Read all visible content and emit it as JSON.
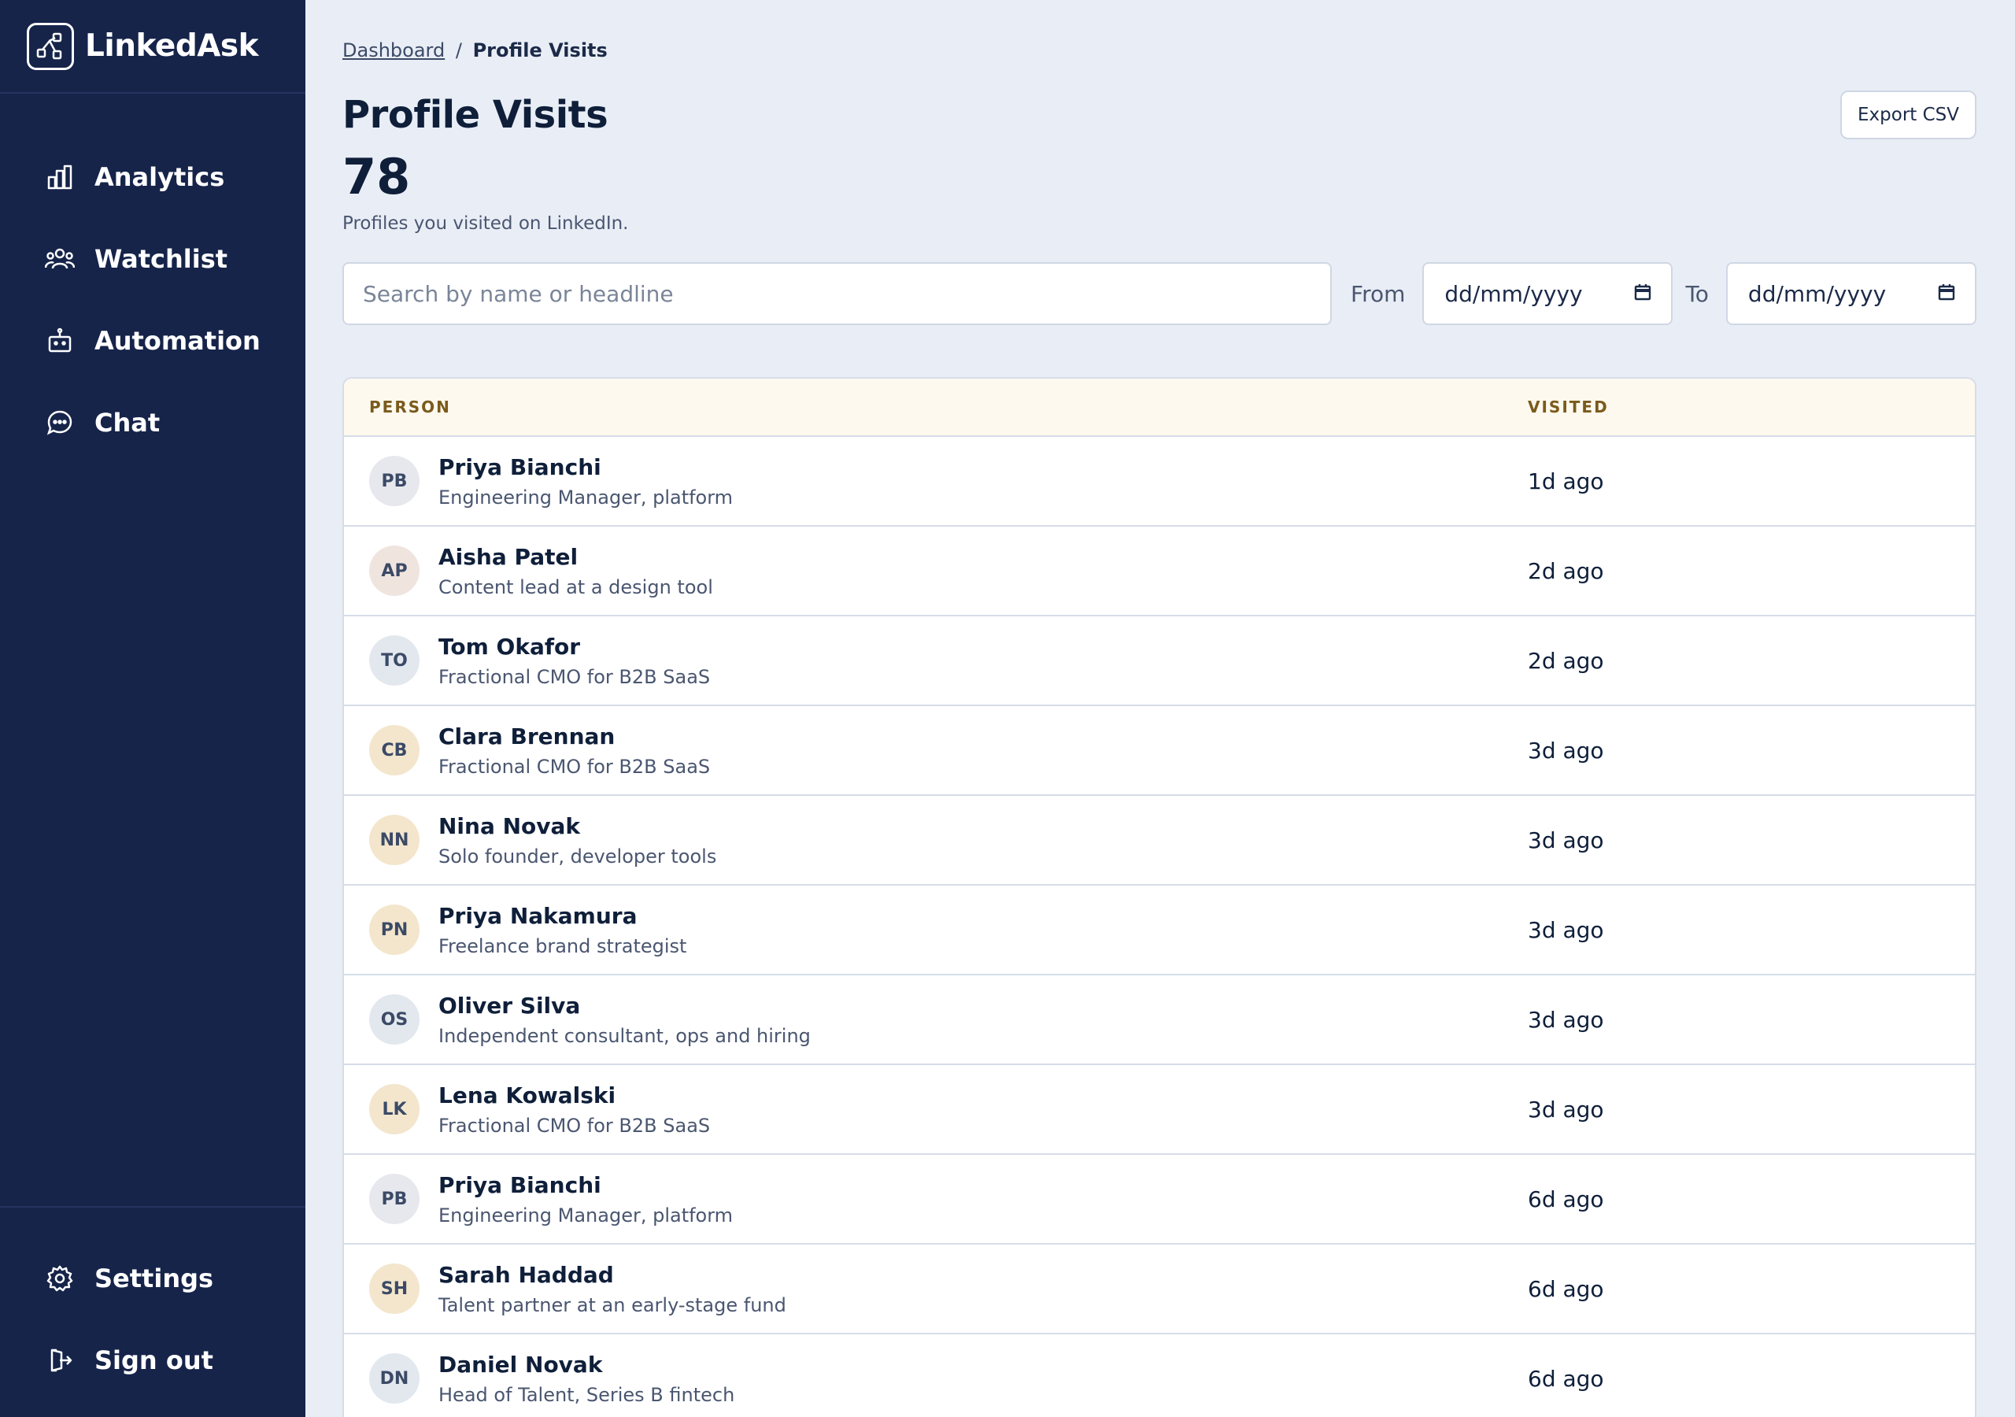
{
  "app": {
    "name": "LinkedAsk"
  },
  "sidebar": {
    "nav": [
      {
        "label": "Analytics",
        "icon": "bar-chart-icon"
      },
      {
        "label": "Watchlist",
        "icon": "users-icon"
      },
      {
        "label": "Automation",
        "icon": "robot-icon"
      },
      {
        "label": "Chat",
        "icon": "chat-bubble-icon"
      }
    ],
    "bottom": [
      {
        "label": "Settings",
        "icon": "gear-icon"
      },
      {
        "label": "Sign out",
        "icon": "sign-out-icon"
      }
    ]
  },
  "breadcrumb": {
    "parent": "Dashboard",
    "separator": "/",
    "current": "Profile Visits"
  },
  "header": {
    "title": "Profile Visits",
    "count": "78",
    "subtitle": "Profiles you visited on LinkedIn.",
    "export_label": "Export CSV"
  },
  "filters": {
    "search_placeholder": "Search by name or headline",
    "from_label": "From",
    "from_value": "dd/mm/yyyy",
    "to_label": "To",
    "to_value": "dd/mm/yyyy"
  },
  "table": {
    "headers": {
      "person": "PERSON",
      "visited": "VISITED"
    },
    "rows": [
      {
        "initials": "PB",
        "name": "Priya Bianchi",
        "headline": "Engineering Manager, platform",
        "visited": "1d ago",
        "avatar_color": "#e7e8ee"
      },
      {
        "initials": "AP",
        "name": "Aisha Patel",
        "headline": "Content lead at a design tool",
        "visited": "2d ago",
        "avatar_color": "#f0e4df"
      },
      {
        "initials": "TO",
        "name": "Tom Okafor",
        "headline": "Fractional CMO for B2B SaaS",
        "visited": "2d ago",
        "avatar_color": "#e3e8ef"
      },
      {
        "initials": "CB",
        "name": "Clara Brennan",
        "headline": "Fractional CMO for B2B SaaS",
        "visited": "3d ago",
        "avatar_color": "#f3e6cd"
      },
      {
        "initials": "NN",
        "name": "Nina Novak",
        "headline": "Solo founder, developer tools",
        "visited": "3d ago",
        "avatar_color": "#f3e6cd"
      },
      {
        "initials": "PN",
        "name": "Priya Nakamura",
        "headline": "Freelance brand strategist",
        "visited": "3d ago",
        "avatar_color": "#f3e6cd"
      },
      {
        "initials": "OS",
        "name": "Oliver Silva",
        "headline": "Independent consultant, ops and hiring",
        "visited": "3d ago",
        "avatar_color": "#e3e8ef"
      },
      {
        "initials": "LK",
        "name": "Lena Kowalski",
        "headline": "Fractional CMO for B2B SaaS",
        "visited": "3d ago",
        "avatar_color": "#f3e6cd"
      },
      {
        "initials": "PB",
        "name": "Priya Bianchi",
        "headline": "Engineering Manager, platform",
        "visited": "6d ago",
        "avatar_color": "#e7e8ee"
      },
      {
        "initials": "SH",
        "name": "Sarah Haddad",
        "headline": "Talent partner at an early-stage fund",
        "visited": "6d ago",
        "avatar_color": "#f3e6cd"
      },
      {
        "initials": "DN",
        "name": "Daniel Novak",
        "headline": "Head of Talent, Series B fintech",
        "visited": "6d ago",
        "avatar_color": "#e3e8ef"
      }
    ]
  },
  "colors": {
    "sidebar_bg": "#16244a",
    "page_bg": "#e9eef6",
    "header_bg": "#fdf9ee",
    "header_text": "#7a5a1c"
  }
}
